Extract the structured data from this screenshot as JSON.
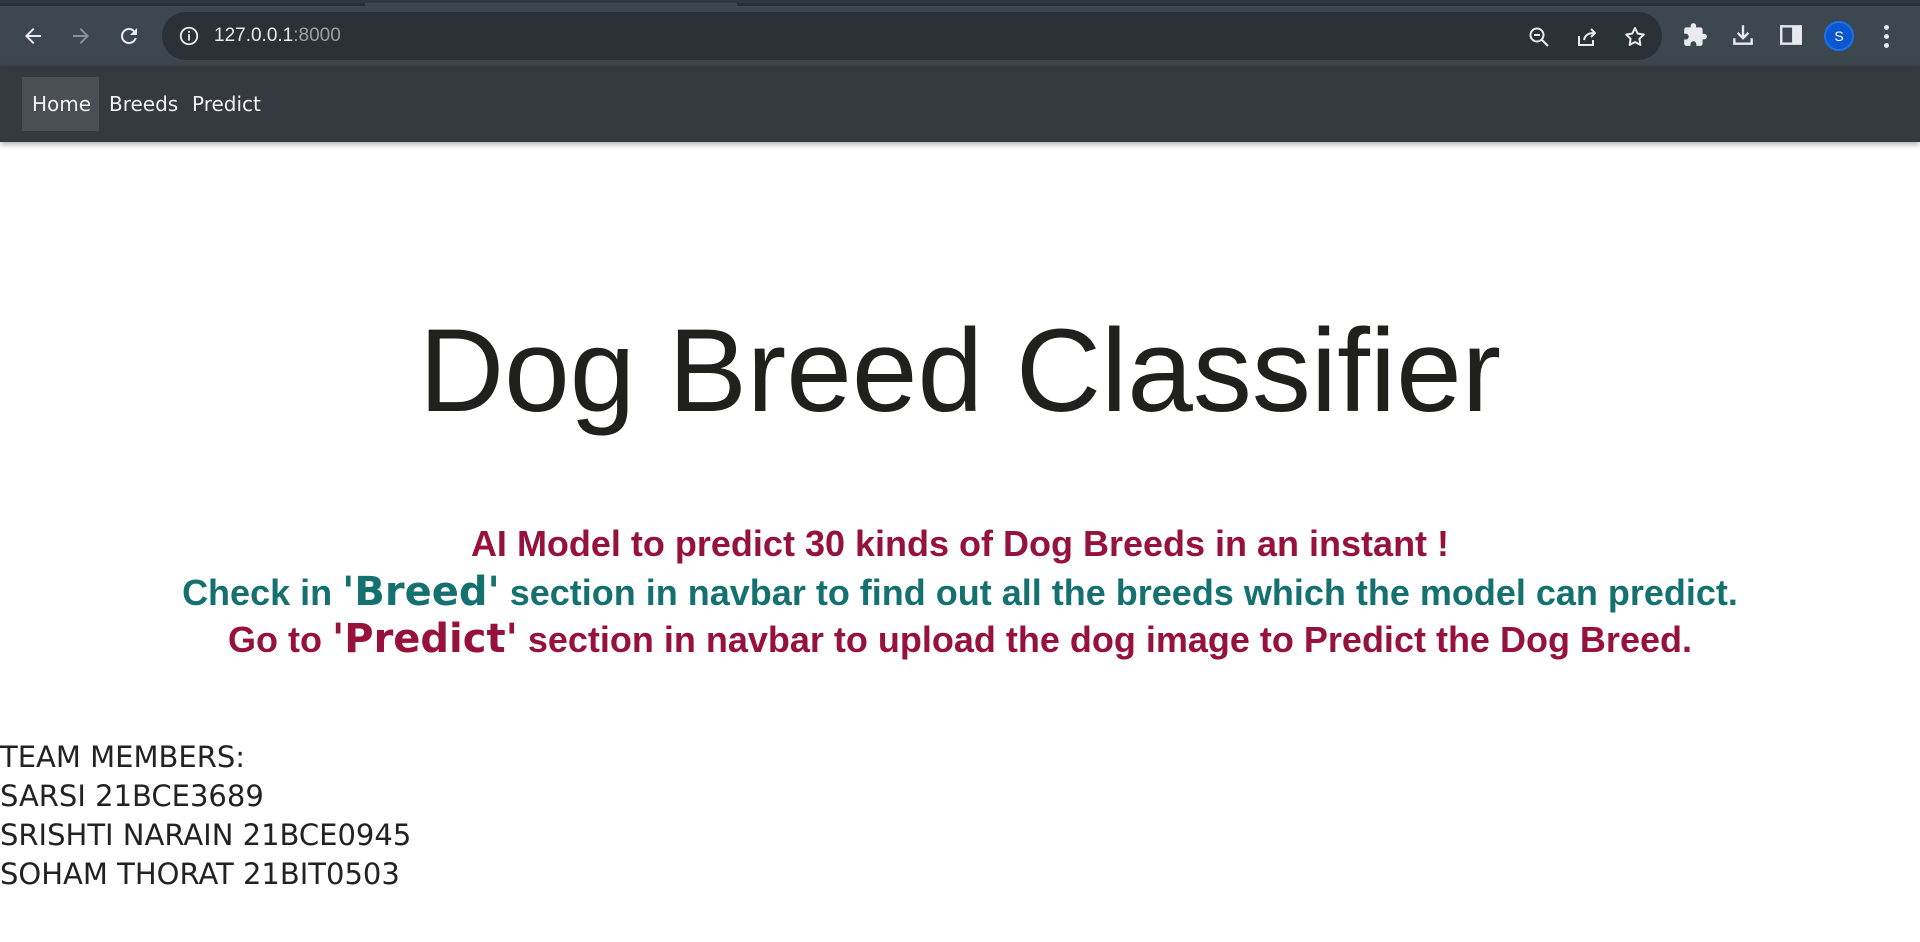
{
  "browser": {
    "url_host": "127.0.0.1",
    "url_port": ":8000",
    "avatar_initial": "S"
  },
  "navbar": {
    "items": [
      {
        "label": "Home",
        "active": true
      },
      {
        "label": "Breeds",
        "active": false
      },
      {
        "label": "Predict",
        "active": false
      }
    ]
  },
  "main": {
    "title": "Dog Breed Classifier",
    "line1": "AI Model to predict 30 kinds of Dog Breeds in an instant !",
    "line2_pre": "Check in ",
    "line2_em": "'Breed'",
    "line2_post": " section in navbar to find out all the breeds which the model can predict.",
    "line3_pre": "Go to ",
    "line3_em": "'Predict'",
    "line3_post": " section in navbar to upload the dog image to Predict the Dog Breed."
  },
  "team": {
    "heading": "TEAM MEMBERS:",
    "members": [
      "SARSI 21BCE3689",
      "SRISHTI NARAIN 21BCE0945",
      "SOHAM THORAT 21BIT0503"
    ]
  },
  "colors": {
    "browser_bar": "#3c474f",
    "navbar_bg": "#343a40",
    "crimson": "#96123a",
    "teal": "#157070",
    "title": "#20201d"
  },
  "icons": {
    "back": "arrow-left-icon",
    "forward": "arrow-right-icon",
    "reload": "reload-icon",
    "info": "info-icon",
    "zoom": "zoom-out-icon",
    "share": "share-icon",
    "bookmark": "star-icon",
    "extensions": "puzzle-icon",
    "downloads": "download-icon",
    "side_panel": "side-panel-icon",
    "menu": "kebab-menu-icon"
  }
}
